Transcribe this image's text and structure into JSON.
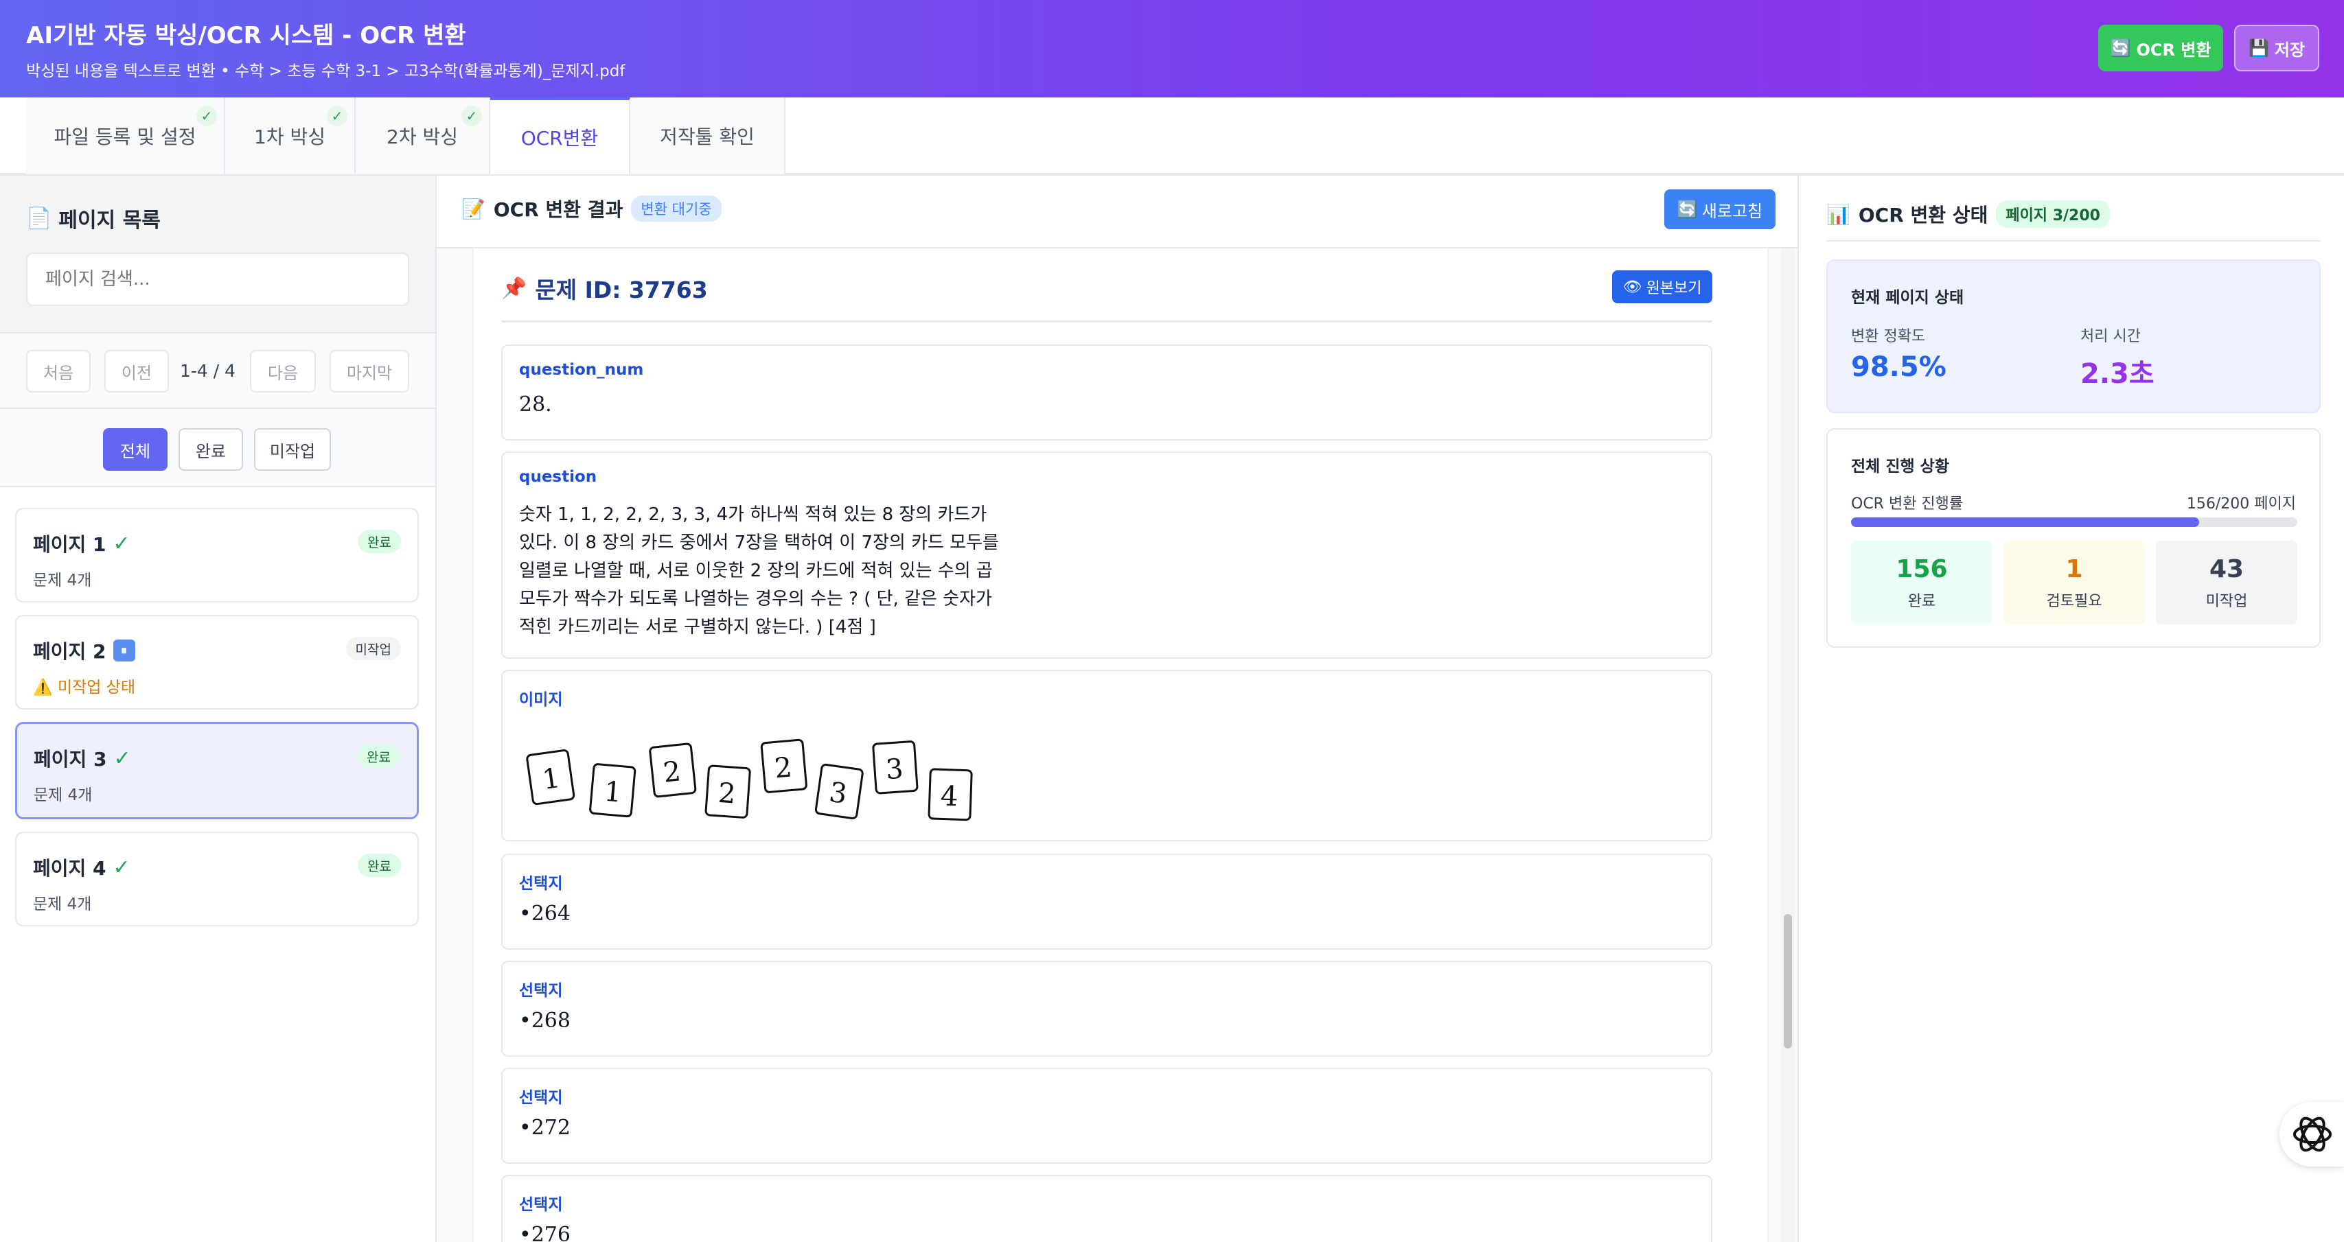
{
  "header": {
    "title": "AI기반 자동 박싱/OCR 시스템 - OCR 변환",
    "subtitle": "박싱된 내용을 텍스트로 변환 • 수학 > 초등 수학 3-1 > 고3수학(확률과통계)_문제지.pdf",
    "ocr_button": "OCR 변환",
    "save_button": "저장"
  },
  "tabs": [
    {
      "label": "파일 등록 및 설정",
      "done": true
    },
    {
      "label": "1차 박싱",
      "done": true
    },
    {
      "label": "2차 박싱",
      "done": true
    },
    {
      "label": "OCR변환",
      "done": false,
      "active": true
    },
    {
      "label": "저작툴 확인",
      "done": false
    }
  ],
  "sidebar": {
    "title": "페이지 목록",
    "search_placeholder": "페이지 검색...",
    "pager": {
      "first": "처음",
      "prev": "이전",
      "info": "1-4 / 4",
      "next": "다음",
      "last": "마지막"
    },
    "filters": [
      "전체",
      "완료",
      "미작업"
    ],
    "pages": [
      {
        "name": "페이지 1",
        "status": "완료",
        "sub": "문제 4개",
        "state": "done"
      },
      {
        "name": "페이지 2",
        "status": "미작업",
        "sub": "미작업 상태",
        "state": "todo"
      },
      {
        "name": "페이지 3",
        "status": "완료",
        "sub": "문제 4개",
        "state": "done",
        "selected": true
      },
      {
        "name": "페이지 4",
        "status": "완료",
        "sub": "문제 4개",
        "state": "done"
      }
    ]
  },
  "main": {
    "title": "OCR 변환 결과",
    "status_badge": "변환 대기중",
    "refresh_button": "새로고침",
    "question_id": "문제 ID: 37763",
    "original_button": "원본보기",
    "fields": {
      "question_num_label": "question_num",
      "question_num_value": "28.",
      "question_label": "question",
      "question_lines": [
        "숫자 1, 1, 2, 2, 2, 3, 3, 4가 하나씩 적혀 있는 8 장의 카드가",
        "있다. 이 8 장의 카드 중에서 7장을 택하여 이 7장의 카드 모두를",
        "일렬로 나열할 때, 서로 이웃한 2 장의 카드에 적혀 있는 수의 곱",
        "모두가 짝수가 되도록 나열하는 경우의 수는 ? ( 단, 같은 숫자가",
        "적힌 카드끼리는 서로 구별하지 않는다. ) [4점 ]"
      ],
      "image_label": "이미지",
      "image_cards": [
        "1",
        "1",
        "2",
        "2",
        "2",
        "3",
        "3",
        "4"
      ],
      "choice_label": "선택지",
      "choices": [
        "•264",
        "•268",
        "•272",
        "•276"
      ]
    }
  },
  "status_panel": {
    "title": "OCR 변환 상태",
    "page_badge": "페이지 3/200",
    "current_title": "현재 페이지 상태",
    "accuracy_label": "변환 정확도",
    "accuracy_value": "98.5%",
    "time_label": "처리 시간",
    "time_value": "2.3초",
    "progress_title": "전체 진행 상황",
    "progress_label": "OCR 변환 진행률",
    "progress_text": "156/200 페이지",
    "progress_fraction": 0.78,
    "done_count": "156",
    "done_label": "완료",
    "review_count": "1",
    "review_label": "검토필요",
    "todo_count": "43",
    "todo_label": "미작업"
  },
  "colors": {
    "accent": "#6366f1",
    "success": "#22a35a",
    "warning": "#d97706",
    "info": "#3b82f6"
  }
}
